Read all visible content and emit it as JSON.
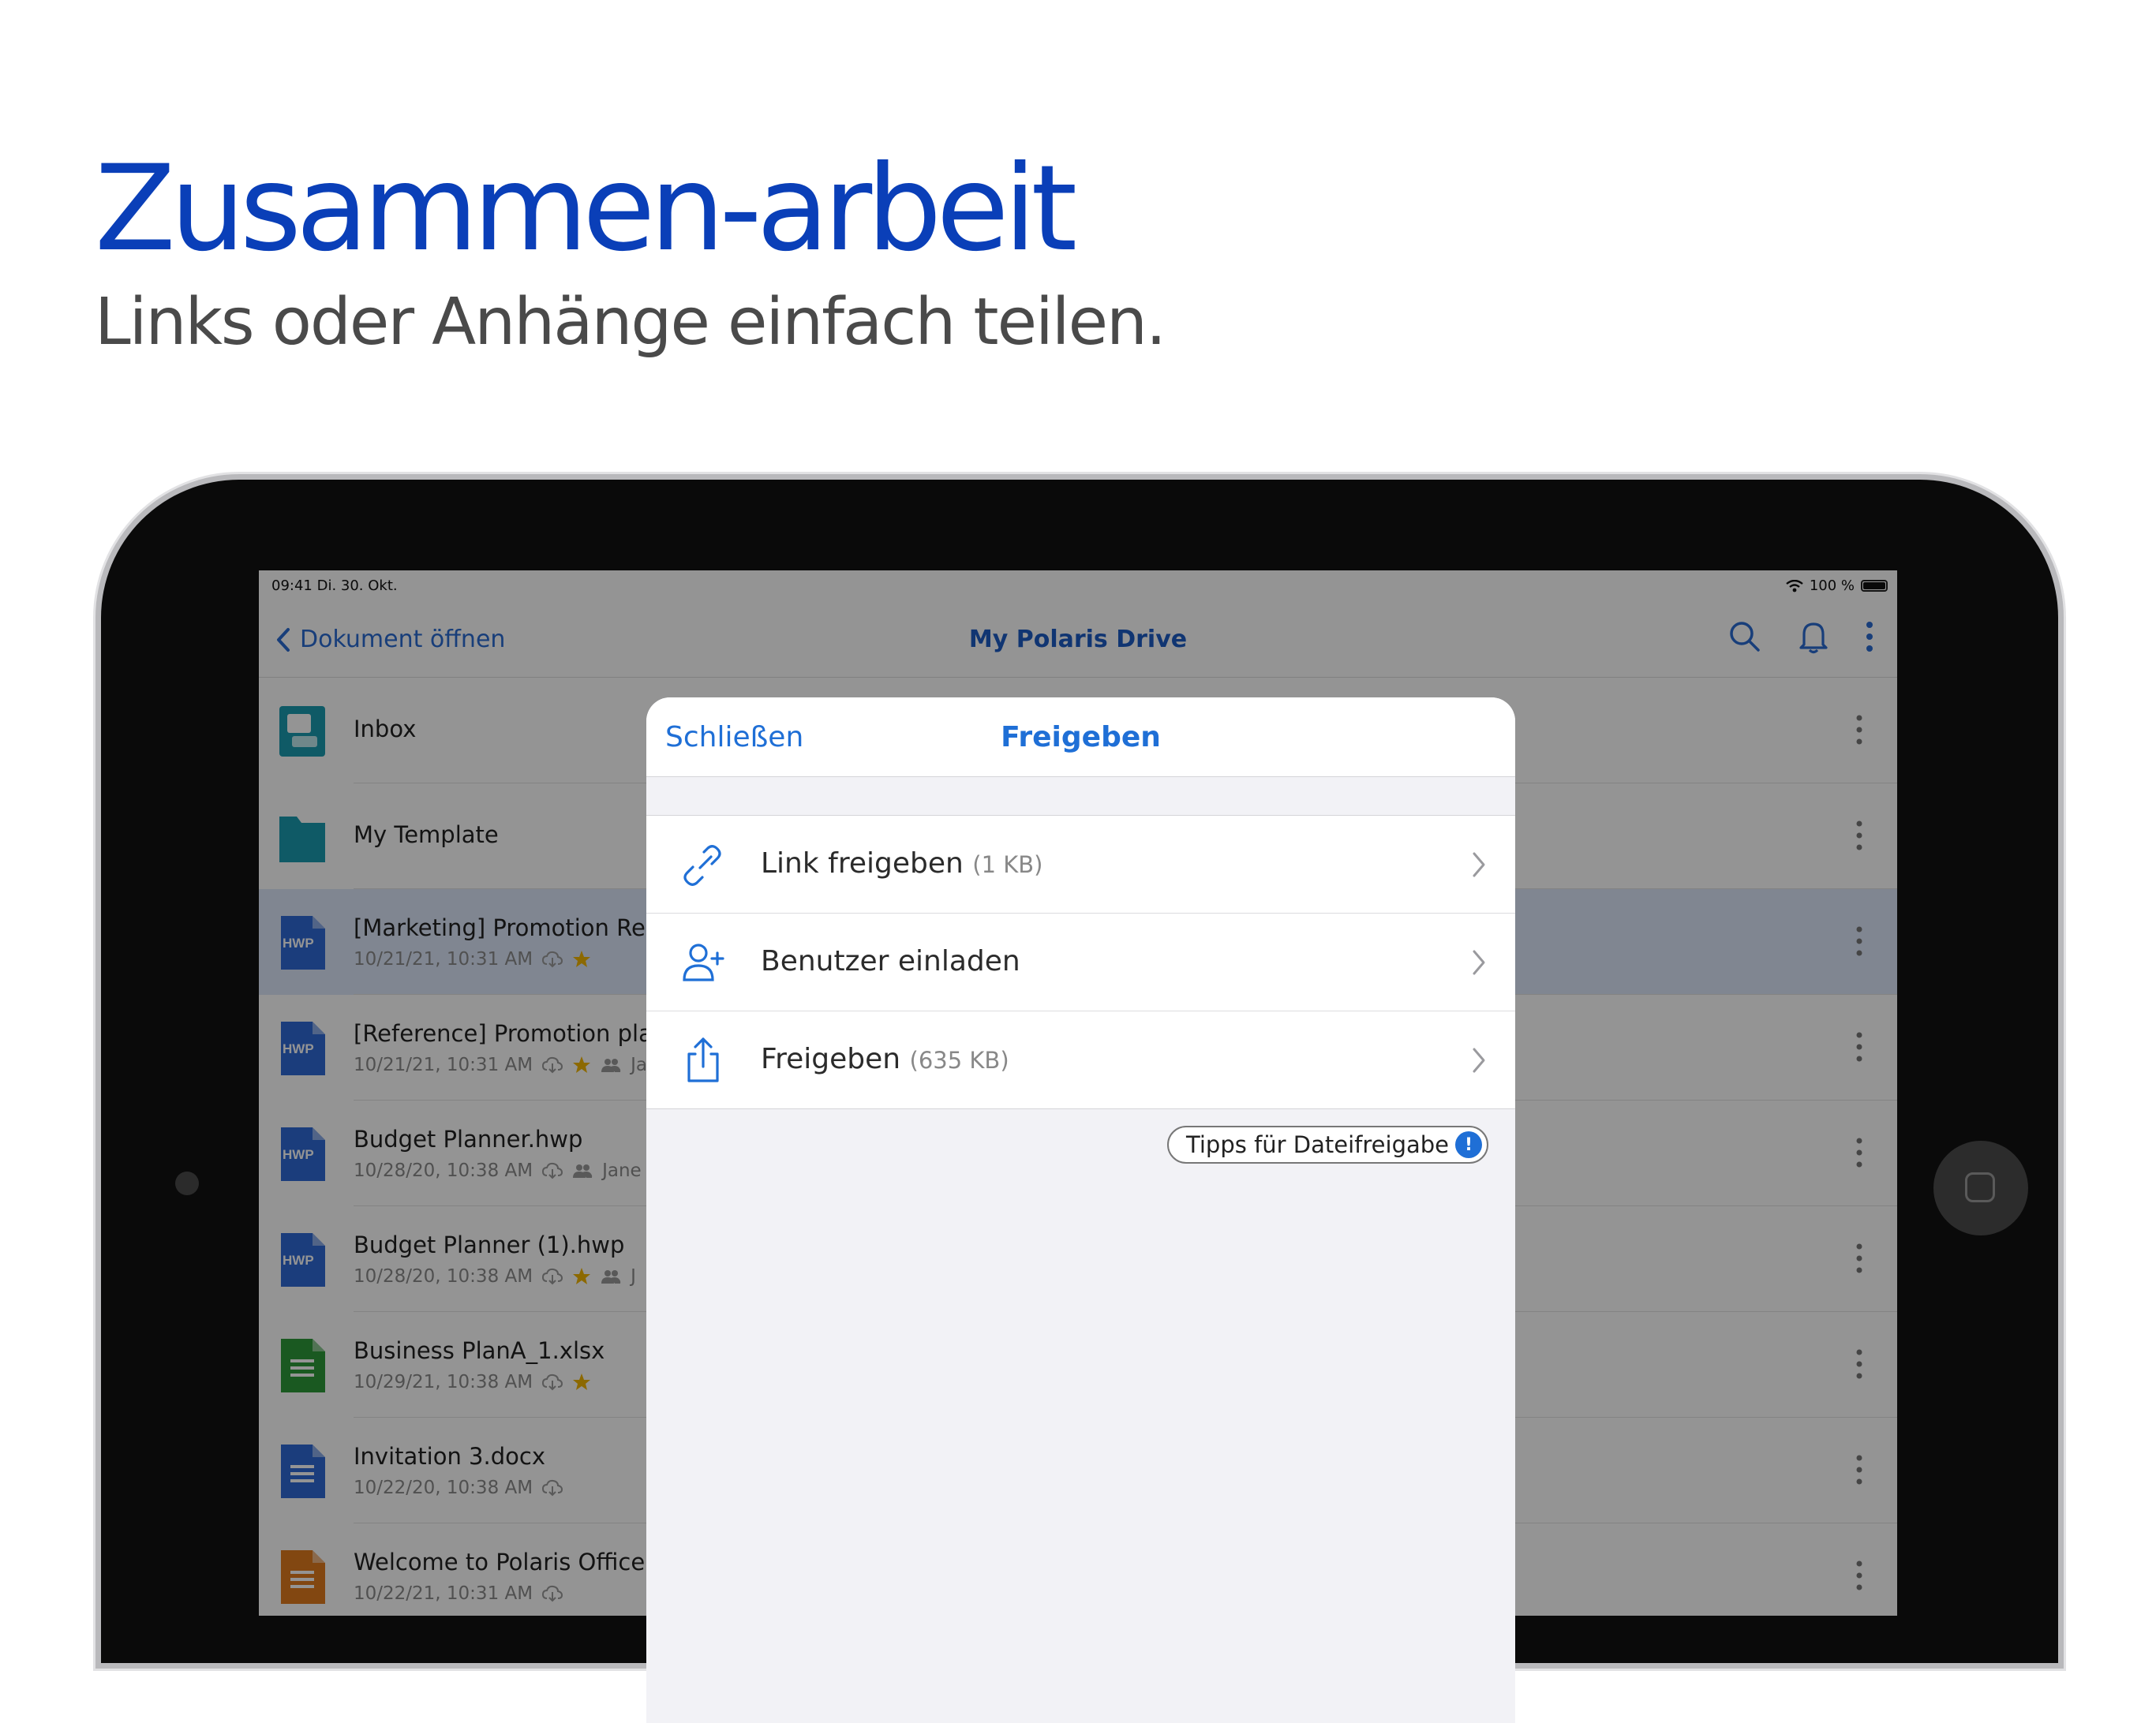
{
  "hero": {
    "title": "Zusammen-arbeit",
    "subtitle": "Links oder Anhänge einfach teilen."
  },
  "status_bar": {
    "time_date": "09:41  Di. 30. Okt.",
    "battery": "100 %"
  },
  "nav": {
    "back_label": "Dokument öffnen",
    "title": "My Polaris Drive",
    "icons": [
      "search-icon",
      "bell-icon",
      "more-icon"
    ]
  },
  "files": [
    {
      "name": "Inbox",
      "meta": "",
      "icon": "inbox",
      "star": false,
      "shared": false,
      "owner": "",
      "highlight": false
    },
    {
      "name": "My Template",
      "meta": "",
      "icon": "folder",
      "star": false,
      "shared": false,
      "owner": "",
      "highlight": false
    },
    {
      "name": "[Marketing] Promotion Repo",
      "meta": "10/21/21, 10:31 AM",
      "icon": "hwp",
      "star": true,
      "shared": false,
      "owner": "",
      "highlight": true
    },
    {
      "name": "[Reference] Promotion plan",
      "meta": "10/21/21, 10:31 AM",
      "icon": "hwp",
      "star": true,
      "shared": true,
      "owner": "Ja",
      "highlight": false
    },
    {
      "name": "Budget Planner.hwp",
      "meta": "10/28/20, 10:38 AM",
      "icon": "hwp",
      "star": false,
      "shared": true,
      "owner": "Jane",
      "highlight": false
    },
    {
      "name": "Budget Planner (1).hwp",
      "meta": "10/28/20, 10:38 AM",
      "icon": "hwp",
      "star": true,
      "shared": true,
      "owner": "J",
      "highlight": false
    },
    {
      "name": "Business PlanA_1.xlsx",
      "meta": "10/29/21, 10:38 AM",
      "icon": "xlsx",
      "star": true,
      "shared": false,
      "owner": "",
      "highlight": false
    },
    {
      "name": "Invitation 3.docx",
      "meta": "10/22/20, 10:38 AM",
      "icon": "docx",
      "star": false,
      "shared": false,
      "owner": "",
      "highlight": false
    },
    {
      "name": "Welcome to Polaris Office.p",
      "meta": "10/22/21, 10:31 AM",
      "icon": "pptx",
      "star": false,
      "shared": false,
      "owner": "",
      "highlight": false
    }
  ],
  "share_sheet": {
    "close_label": "Schließen",
    "title": "Freigeben",
    "options": [
      {
        "label": "Link freigeben",
        "size": "(1 KB)",
        "icon": "link-icon"
      },
      {
        "label": "Benutzer einladen",
        "size": "",
        "icon": "add-user-icon"
      },
      {
        "label": "Freigeben",
        "size": "(635 KB)",
        "icon": "share-icon"
      }
    ],
    "tips_label": "Tipps für Dateifreigabe",
    "tips_badge": "!"
  },
  "colors": {
    "headline": "#0a3fb8",
    "accent": "#1f6fd6",
    "hwp": "#2f6ad6",
    "xlsx": "#2e9a3a",
    "docx": "#2f6ad6",
    "pptx": "#e07a1e",
    "star": "#f2b600"
  }
}
